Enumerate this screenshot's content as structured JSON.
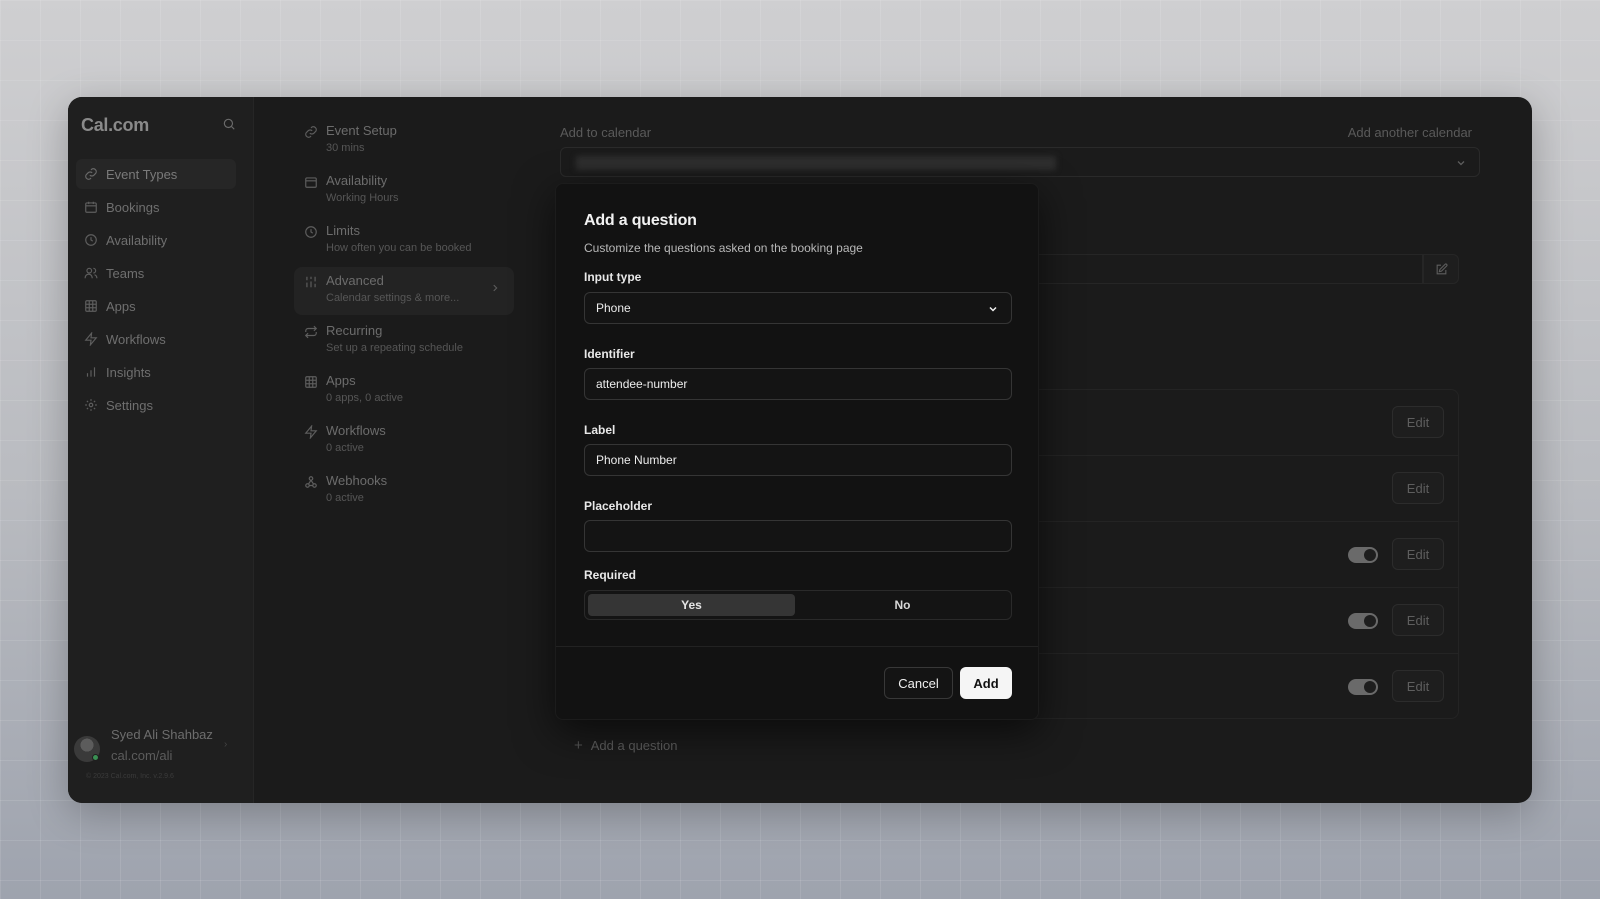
{
  "app": {
    "logo": "Cal.com",
    "copyright": "© 2023 Cal.com, Inc. v.2.9.6"
  },
  "sidebar": {
    "items": [
      {
        "label": "Event Types",
        "icon": "link-icon",
        "active": true
      },
      {
        "label": "Bookings",
        "icon": "calendar-icon"
      },
      {
        "label": "Availability",
        "icon": "clock-icon"
      },
      {
        "label": "Teams",
        "icon": "users-icon"
      },
      {
        "label": "Apps",
        "icon": "grid-icon"
      },
      {
        "label": "Workflows",
        "icon": "zap-icon"
      },
      {
        "label": "Insights",
        "icon": "bar-chart-icon"
      },
      {
        "label": "Settings",
        "icon": "settings-icon"
      }
    ],
    "user": {
      "name": "Syed Ali Shahbaz",
      "url": "cal.com/ali"
    }
  },
  "event_setup": {
    "items": [
      {
        "title": "Event Setup",
        "subtitle": "30 mins",
        "icon": "link-icon"
      },
      {
        "title": "Availability",
        "subtitle": "Working Hours",
        "icon": "calendar-icon"
      },
      {
        "title": "Limits",
        "subtitle": "How often you can be booked",
        "icon": "clock-icon"
      },
      {
        "title": "Advanced",
        "subtitle": "Calendar settings & more...",
        "icon": "sliders-icon",
        "active": true
      },
      {
        "title": "Recurring",
        "subtitle": "Set up a repeating schedule",
        "icon": "repeat-icon"
      },
      {
        "title": "Apps",
        "subtitle": "0 apps, 0 active",
        "icon": "grid-icon"
      },
      {
        "title": "Workflows",
        "subtitle": "0 active",
        "icon": "zap-icon"
      },
      {
        "title": "Webhooks",
        "subtitle": "0 active",
        "icon": "webhook-icon"
      }
    ]
  },
  "main": {
    "add_to_calendar_label": "Add to calendar",
    "add_another_calendar": "Add another calendar",
    "edit_label": "Edit",
    "add_question": "Add a question"
  },
  "modal": {
    "title": "Add a question",
    "description": "Customize the questions asked on the booking page",
    "input_type_label": "Input type",
    "input_type_value": "Phone",
    "identifier_label": "Identifier",
    "identifier_value": "attendee-number",
    "label_label": "Label",
    "label_value": "Phone Number",
    "placeholder_label": "Placeholder",
    "placeholder_value": "",
    "required_label": "Required",
    "required_yes": "Yes",
    "required_no": "No",
    "required_selected": "Yes",
    "cancel": "Cancel",
    "add": "Add"
  }
}
